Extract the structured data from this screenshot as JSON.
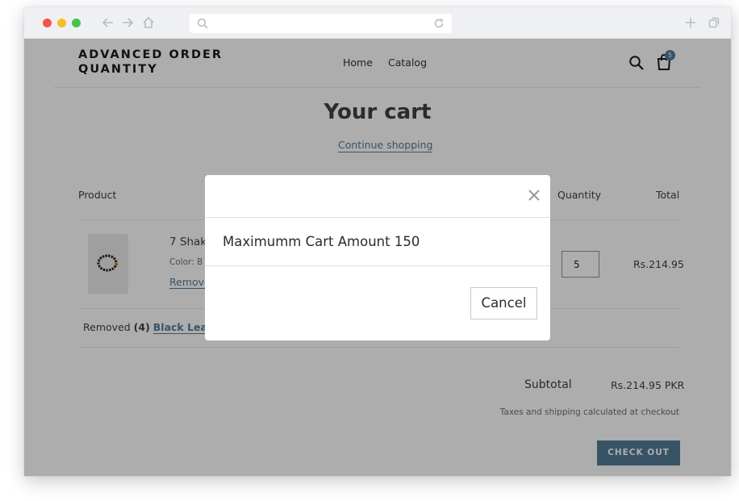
{
  "browser": {
    "address_value": "",
    "controls": [
      "close-dot",
      "minimize-dot",
      "maximize-dot",
      "back-icon",
      "forward-icon",
      "home-icon",
      "reload-icon",
      "new-tab-icon",
      "tabs-icon"
    ]
  },
  "store": {
    "name": "ADVANCED ORDER QUANTITY",
    "nav": {
      "home": "Home",
      "catalog": "Catalog"
    },
    "cart_count": "5"
  },
  "cart": {
    "title": "Your cart",
    "continue_link": "Continue shopping",
    "columns": {
      "product": "Product",
      "quantity": "Quantity",
      "total": "Total"
    },
    "item": {
      "title": "7 Shak",
      "color": "Color: B",
      "remove": "Remove",
      "quantity": "5",
      "line_total": "Rs.214.95"
    },
    "removed_notice": {
      "prefix": "Removed",
      "count": "(4)",
      "link": "Black Leath"
    },
    "subtotal_label": "Subtotal",
    "subtotal_value": "Rs.214.95 PKR",
    "tax_note": "Taxes and shipping calculated at checkout",
    "checkout_button": "CHECK OUT"
  },
  "modal": {
    "message": "Maximumm Cart Amount 150",
    "cancel": "Cancel"
  },
  "colors": {
    "accent": "#557b97",
    "text": "#3d4246",
    "overlay": "rgba(0,0,0,0.32)"
  }
}
